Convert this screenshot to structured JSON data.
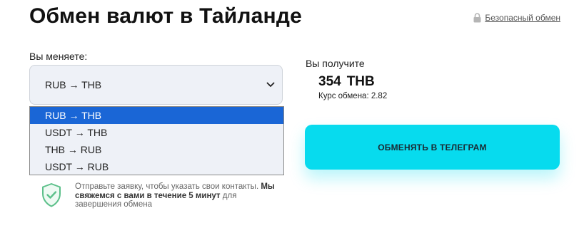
{
  "header": {
    "title": "Обмен валют в Тайланде",
    "secure_label": "Безопасный обмен",
    "secure_icon": "lock-icon"
  },
  "give": {
    "label": "Вы меняете:",
    "selected": "RUB → THB",
    "options": [
      "RUB → THB",
      "USDT → THB",
      "THB → RUB",
      "USDT → RUB"
    ],
    "highlighted_index": 0,
    "highlight_color": "#1a66d6"
  },
  "get": {
    "label": "Вы получите",
    "amount": "354",
    "currency": "THB",
    "rate_label": "Курс обмена:",
    "rate_value": "2.82"
  },
  "button": {
    "label": "ОБМЕНЯТЬ В ТЕЛЕГРАМ",
    "color": "#07dbee"
  },
  "notice": {
    "text_before": "Отправьте заявку, чтобы указать свои контакты.",
    "text_bold": "Мы свяжемся с вами в течение 5 минут",
    "text_after": "для завершения обмена",
    "icon": "shield-check-icon",
    "icon_color": "#5cc08a"
  }
}
